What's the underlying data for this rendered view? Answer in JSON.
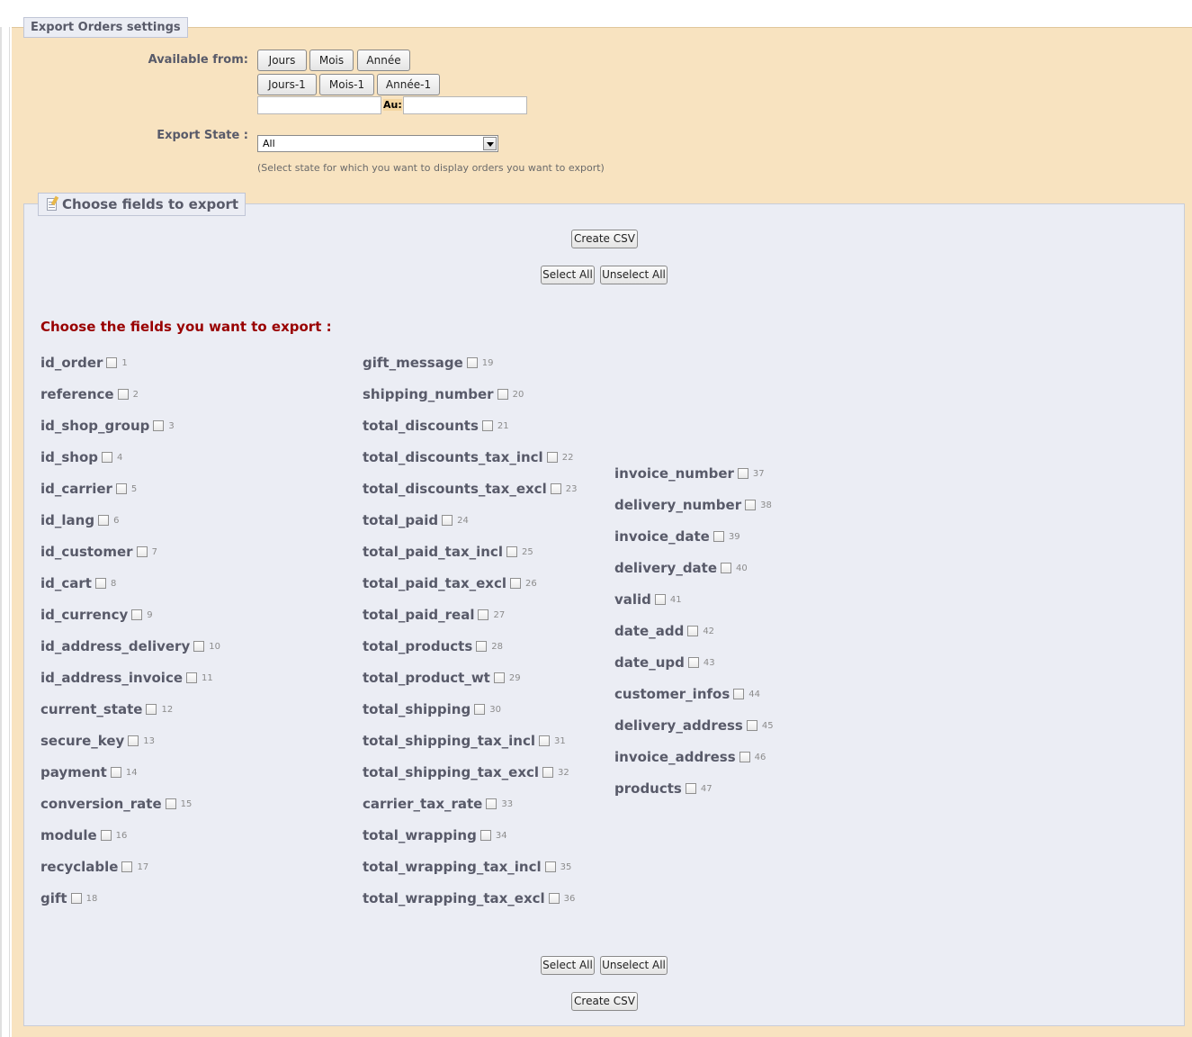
{
  "export_settings": {
    "legend": "Export Orders settings",
    "available_from_label": "Available from:",
    "period_buttons_row1": [
      "Jours",
      "Mois",
      "Année"
    ],
    "period_buttons_row2": [
      "Jours-1",
      "Mois-1",
      "Année-1"
    ],
    "date_from_value": "",
    "date_to_label": "Au:",
    "date_to_value": "",
    "export_state_label": "Export State :",
    "export_state_selected": "All",
    "export_state_help": "(Select state for which you want to display orders you want to export)"
  },
  "fields_panel": {
    "legend": "Choose fields to export",
    "legend_icon": "notepad-icon",
    "create_csv_label": "Create CSV",
    "select_all_label": "Select All",
    "unselect_all_label": "Unselect All",
    "heading": "Choose the fields you want to export :",
    "fields": [
      {
        "name": "id_order",
        "num": "1"
      },
      {
        "name": "reference",
        "num": "2"
      },
      {
        "name": "id_shop_group",
        "num": "3"
      },
      {
        "name": "id_shop",
        "num": "4"
      },
      {
        "name": "id_carrier",
        "num": "5"
      },
      {
        "name": "id_lang",
        "num": "6"
      },
      {
        "name": "id_customer",
        "num": "7"
      },
      {
        "name": "id_cart",
        "num": "8"
      },
      {
        "name": "id_currency",
        "num": "9"
      },
      {
        "name": "id_address_delivery",
        "num": "10"
      },
      {
        "name": "id_address_invoice",
        "num": "11"
      },
      {
        "name": "current_state",
        "num": "12"
      },
      {
        "name": "secure_key",
        "num": "13"
      },
      {
        "name": "payment",
        "num": "14"
      },
      {
        "name": "conversion_rate",
        "num": "15"
      },
      {
        "name": "module",
        "num": "16"
      },
      {
        "name": "recyclable",
        "num": "17"
      },
      {
        "name": "gift",
        "num": "18"
      },
      {
        "name": "gift_message",
        "num": "19"
      },
      {
        "name": "shipping_number",
        "num": "20"
      },
      {
        "name": "total_discounts",
        "num": "21"
      },
      {
        "name": "total_discounts_tax_incl",
        "num": "22"
      },
      {
        "name": "total_discounts_tax_excl",
        "num": "23"
      },
      {
        "name": "total_paid",
        "num": "24"
      },
      {
        "name": "total_paid_tax_incl",
        "num": "25"
      },
      {
        "name": "total_paid_tax_excl",
        "num": "26"
      },
      {
        "name": "total_paid_real",
        "num": "27"
      },
      {
        "name": "total_products",
        "num": "28"
      },
      {
        "name": "total_product_wt",
        "num": "29"
      },
      {
        "name": "total_shipping",
        "num": "30"
      },
      {
        "name": "total_shipping_tax_incl",
        "num": "31"
      },
      {
        "name": "total_shipping_tax_excl",
        "num": "32"
      },
      {
        "name": "carrier_tax_rate",
        "num": "33"
      },
      {
        "name": "total_wrapping",
        "num": "34"
      },
      {
        "name": "total_wrapping_tax_incl",
        "num": "35"
      },
      {
        "name": "total_wrapping_tax_excl",
        "num": "36"
      },
      {
        "name": "invoice_number",
        "num": "37"
      },
      {
        "name": "delivery_number",
        "num": "38"
      },
      {
        "name": "invoice_date",
        "num": "39"
      },
      {
        "name": "delivery_date",
        "num": "40"
      },
      {
        "name": "valid",
        "num": "41"
      },
      {
        "name": "date_add",
        "num": "42"
      },
      {
        "name": "date_upd",
        "num": "43"
      },
      {
        "name": "customer_infos",
        "num": "44"
      },
      {
        "name": "delivery_address",
        "num": "45"
      },
      {
        "name": "invoice_address",
        "num": "46"
      },
      {
        "name": "products",
        "num": "47"
      }
    ]
  }
}
